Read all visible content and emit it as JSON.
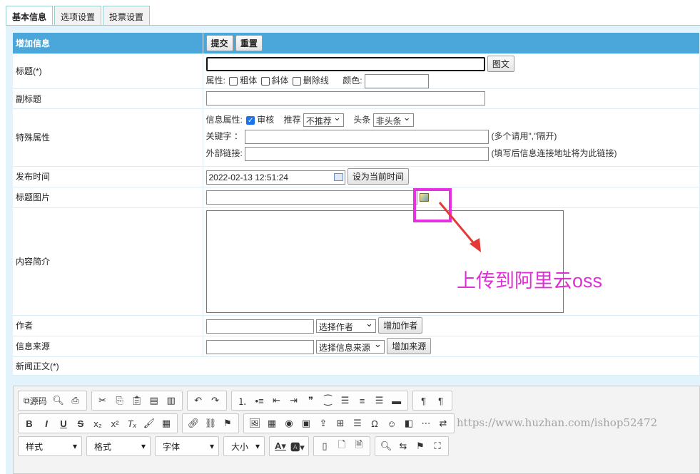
{
  "tabs": [
    "基本信息",
    "选项设置",
    "投票设置"
  ],
  "header": {
    "title": "增加信息",
    "submit": "提交",
    "reset": "重置"
  },
  "fields": {
    "title": {
      "label": "标题(*)",
      "btn": "图文",
      "attr_label": "属性:",
      "bold": "粗体",
      "italic": "斜体",
      "strike": "删除线",
      "color_label": "颜色:"
    },
    "subtitle": {
      "label": "副标题"
    },
    "special": {
      "label": "特殊属性",
      "info_attr": "信息属性:",
      "audit": "审核",
      "audit_checked": true,
      "recommend": "推荐",
      "recommend_value": "不推荐",
      "headline": "头条",
      "headline_value": "非头条",
      "keyword_label": "关键字 ：",
      "keyword_hint": "(多个请用\",\"隔开)",
      "link_label": "外部链接:",
      "link_hint": "(填写后信息连接地址将为此链接)"
    },
    "publish": {
      "label": "发布时间",
      "value": "2022-02-13 12:51:24",
      "btn": "设为当前时间"
    },
    "image": {
      "label": "标题图片"
    },
    "summary": {
      "label": "内容简介"
    },
    "author": {
      "label": "作者",
      "select": "选择作者",
      "btn": "增加作者"
    },
    "source": {
      "label": "信息来源",
      "select": "选择信息来源",
      "btn": "增加来源"
    },
    "body": {
      "label": "新闻正文(*)"
    }
  },
  "annotation": "上传到阿里云oss",
  "toolbar": {
    "source": "源码",
    "style": "样式",
    "format": "格式",
    "font": "字体",
    "size": "大小"
  },
  "watermark": "https://www.huzhan.com/ishop52472",
  "colors": {
    "header": "#4ba6d9",
    "annotation": "#e02fd6"
  }
}
